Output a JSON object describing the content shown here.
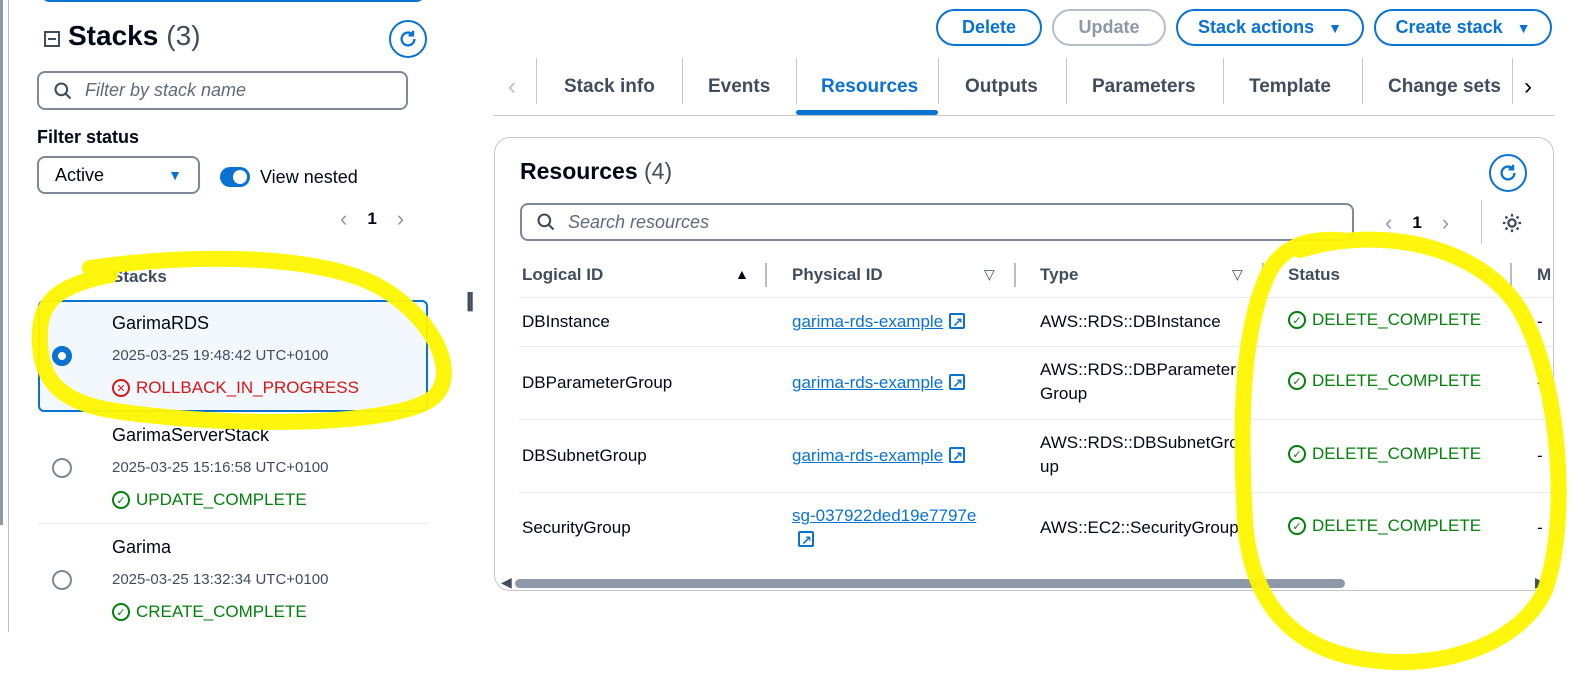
{
  "sidebar": {
    "title": "Stacks",
    "count": "(3)",
    "search_placeholder": "Filter by stack name",
    "filter_status_label": "Filter status",
    "filter_status_value": "Active",
    "view_nested_label": "View nested",
    "page": "1",
    "column_header": "Stacks",
    "stacks": [
      {
        "name": "GarimaRDS",
        "date": "2025-03-25 19:48:42 UTC+0100",
        "status": "ROLLBACK_IN_PROGRESS",
        "status_type": "error",
        "selected": true
      },
      {
        "name": "GarimaServerStack",
        "date": "2025-03-25 15:16:58 UTC+0100",
        "status": "UPDATE_COMPLETE",
        "status_type": "success",
        "selected": false
      },
      {
        "name": "Garima",
        "date": "2025-03-25 13:32:34 UTC+0100",
        "status": "CREATE_COMPLETE",
        "status_type": "success",
        "selected": false
      }
    ]
  },
  "actions": {
    "delete": "Delete",
    "update": "Update",
    "stack_actions": "Stack actions",
    "create_stack": "Create stack"
  },
  "tabs": [
    "Stack info",
    "Events",
    "Resources",
    "Outputs",
    "Parameters",
    "Template",
    "Change sets"
  ],
  "active_tab": "Resources",
  "resources": {
    "title": "Resources",
    "count": "(4)",
    "search_placeholder": "Search resources",
    "page": "1",
    "columns": [
      "Logical ID",
      "Physical ID",
      "Type",
      "Status",
      "M"
    ],
    "rows": [
      {
        "logical_id": "DBInstance",
        "physical_id": "garima-rds-example",
        "type": "AWS::RDS::DBInstance",
        "status": "DELETE_COMPLETE",
        "extra": "-"
      },
      {
        "logical_id": "DBParameterGroup",
        "physical_id": "garima-rds-example",
        "type": "AWS::RDS::DBParameterGroup",
        "status": "DELETE_COMPLETE",
        "extra": "-"
      },
      {
        "logical_id": "DBSubnetGroup",
        "physical_id": "garima-rds-example",
        "type": "AWS::RDS::DBSubnetGroup",
        "status": "DELETE_COMPLETE",
        "extra": "-"
      },
      {
        "logical_id": "SecurityGroup",
        "physical_id": "sg-037922ded19e7797e",
        "type": "AWS::EC2::SecurityGroup",
        "status": "DELETE_COMPLETE",
        "extra": "-"
      }
    ]
  },
  "colors": {
    "accent": "#0972d3",
    "success": "#037f0c",
    "error": "#d91515",
    "highlight": "#fff500"
  }
}
